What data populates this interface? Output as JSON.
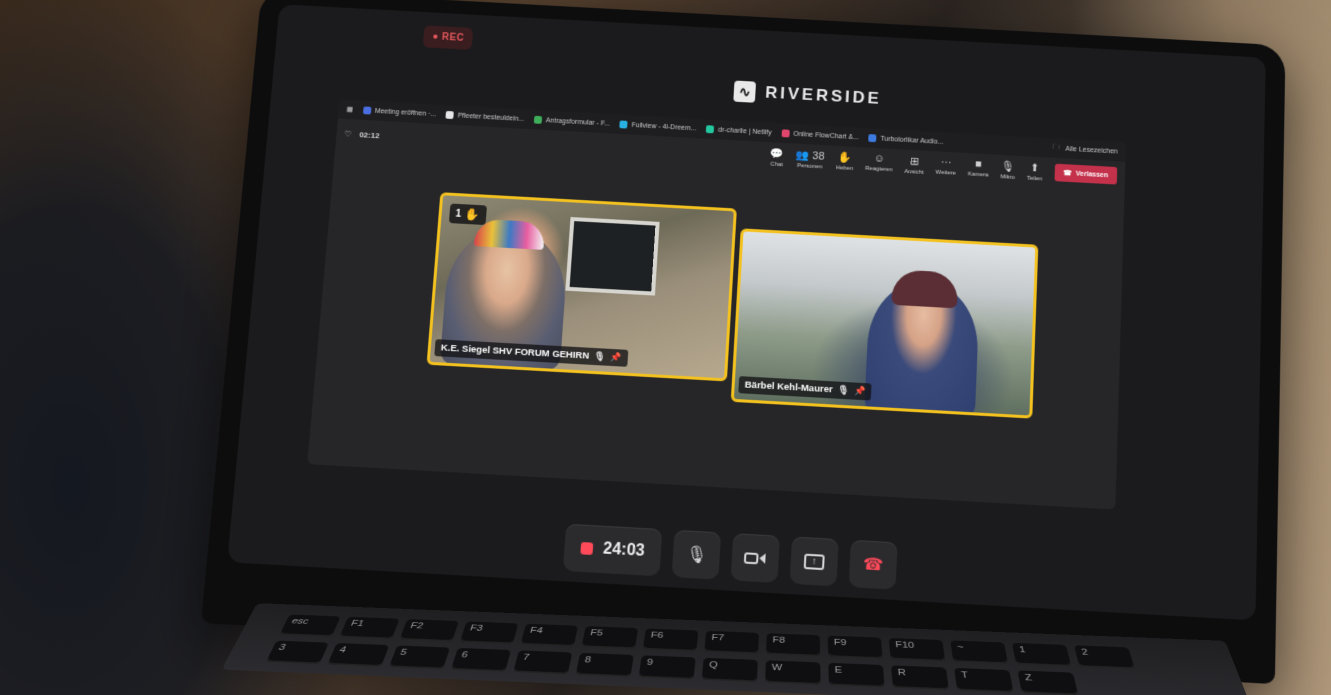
{
  "recording_badge": "● REC",
  "brand": {
    "logo_glyph": "∿",
    "name": "RIVERSIDE"
  },
  "browser_tabs": [
    {
      "label": "Meeting eröffnen ·...",
      "color": "#4a6ee0"
    },
    {
      "label": "Pfleeter besteuldein...",
      "color": "#e6e6e6"
    },
    {
      "label": "Antragsformular - F...",
      "color": "#3fae5a"
    },
    {
      "label": "Fullview - 4i-Dreem...",
      "color": "#28b0e0"
    },
    {
      "label": "dr-charlie | Netlify",
      "color": "#23c8a0"
    },
    {
      "label": "Online FlowChart &...",
      "color": "#e0466b"
    },
    {
      "label": "Turbolorlikar Audio...",
      "color": "#3d7ae0"
    }
  ],
  "browser_right": "Alle Lesezeichen",
  "meeting": {
    "elapsed": "02:12",
    "actions": [
      {
        "icon": "chat-icon",
        "glyph": "💬",
        "label": "Chat"
      },
      {
        "icon": "people-icon",
        "glyph": "👥 38",
        "label": "Personen"
      },
      {
        "icon": "raise-hand-icon",
        "glyph": "✋",
        "label": "Heben"
      },
      {
        "icon": "reactions-icon",
        "glyph": "☺",
        "label": "Reagieren"
      },
      {
        "icon": "view-icon",
        "glyph": "⊞",
        "label": "Ansicht"
      },
      {
        "icon": "more-icon",
        "glyph": "···",
        "label": "Weitere"
      },
      {
        "icon": "camera-icon",
        "glyph": "■",
        "label": "Kamera"
      },
      {
        "icon": "mic-icon",
        "glyph": "🎙",
        "label": "Mikro"
      },
      {
        "icon": "share-icon",
        "glyph": "⬆",
        "label": "Teilen"
      }
    ],
    "leave_label": "Verlassen"
  },
  "participants": [
    {
      "name": "K.E. Siegel SHV FORUM GEHIRN",
      "hand_count": "1",
      "hand_glyph": "✋"
    },
    {
      "name": "Bärbel Kehl-Maurer"
    }
  ],
  "controls": {
    "record_timer": "24:03",
    "mic_glyph": "🎙",
    "share_glyph": "↑",
    "end_glyph": "☎"
  },
  "keyboard_keys": [
    "esc",
    "F1",
    "F2",
    "F3",
    "F4",
    "F5",
    "F6",
    "F7",
    "F8",
    "F9",
    "F10",
    "~",
    "1",
    "2",
    "3",
    "4",
    "5",
    "6",
    "7",
    "8",
    "9",
    "Q",
    "W",
    "E",
    "R",
    "T",
    "Z"
  ],
  "colors": {
    "accent_yellow": "#f4c21f",
    "rec_red": "#ff4a5a",
    "leave_red": "#c4314b"
  }
}
